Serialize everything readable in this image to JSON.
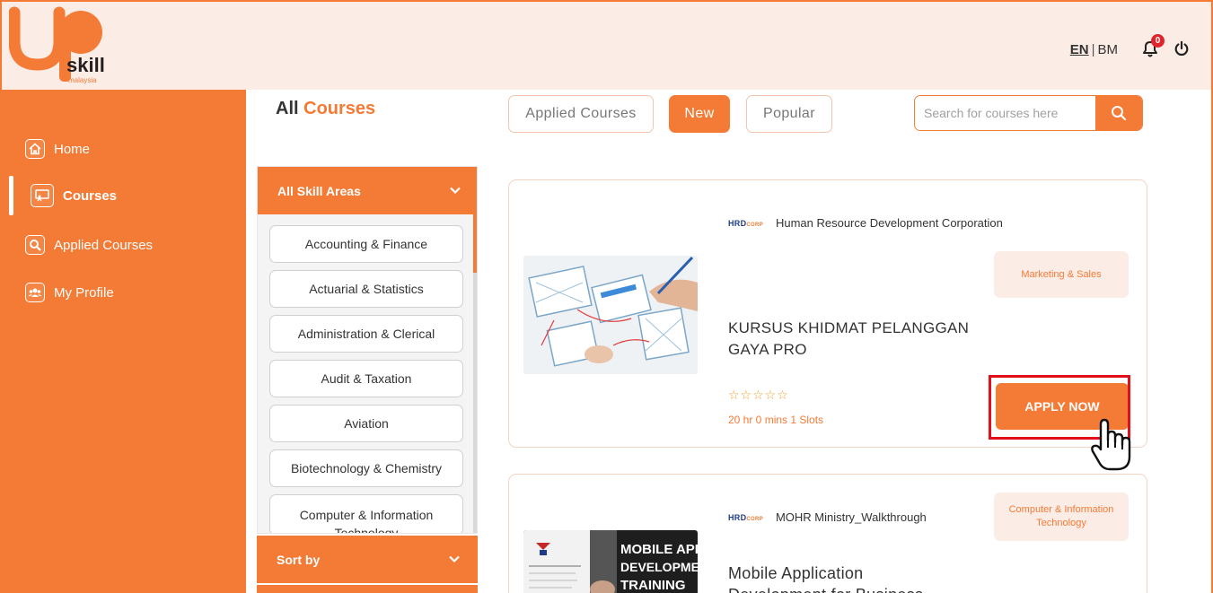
{
  "brand": {
    "logo_text": "skill",
    "logo_sub": "malaysia",
    "accent": "#f47b36",
    "bg_header": "#fcece6"
  },
  "header": {
    "lang_en": "EN",
    "lang_sep": "|",
    "lang_bm": "BM",
    "notification_count": "0"
  },
  "sidebar": {
    "items": [
      {
        "label": "Home",
        "icon": "home-icon"
      },
      {
        "label": "Courses",
        "icon": "courses-icon",
        "active": true
      },
      {
        "label": "Applied Courses",
        "icon": "search-icon"
      },
      {
        "label": "My Profile",
        "icon": "users-icon"
      }
    ]
  },
  "main": {
    "title_prefix": "All",
    "title_accent": "Courses",
    "tabs": [
      {
        "label": "Applied Courses",
        "active": false
      },
      {
        "label": "New",
        "active": true
      },
      {
        "label": "Popular",
        "active": false
      }
    ],
    "search_placeholder": "Search for courses here"
  },
  "filter": {
    "heading": "All Skill Areas",
    "skills": [
      "Accounting & Finance",
      "Actuarial & Statistics",
      "Administration & Clerical",
      "Audit & Taxation",
      "Aviation",
      "Biotechnology & Chemistry",
      "Computer & Information Technology"
    ],
    "sort_label": "Sort by"
  },
  "courses": [
    {
      "provider_logo": "HRD",
      "provider_logo_sub": "CORP",
      "provider": "Human Resource Development Corporation",
      "category": "Marketing & Sales",
      "title_line1": "KURSUS KHIDMAT PELANGGAN",
      "title_line2": "GAYA PRO",
      "rating": "☆☆☆☆☆",
      "meta": "20 hr 0 mins 1 Slots",
      "apply_label": "APPLY NOW"
    },
    {
      "provider_logo": "HRD",
      "provider_logo_sub": "CORP",
      "provider": "MOHR Ministry_Walkthrough",
      "category": "Computer & Information Technology",
      "title_line1": "Mobile Application",
      "title_line2": "Development for Business",
      "thumb_text": [
        "MOBILE APPS",
        "DEVELOPMENT",
        "TRAINING"
      ]
    }
  ]
}
